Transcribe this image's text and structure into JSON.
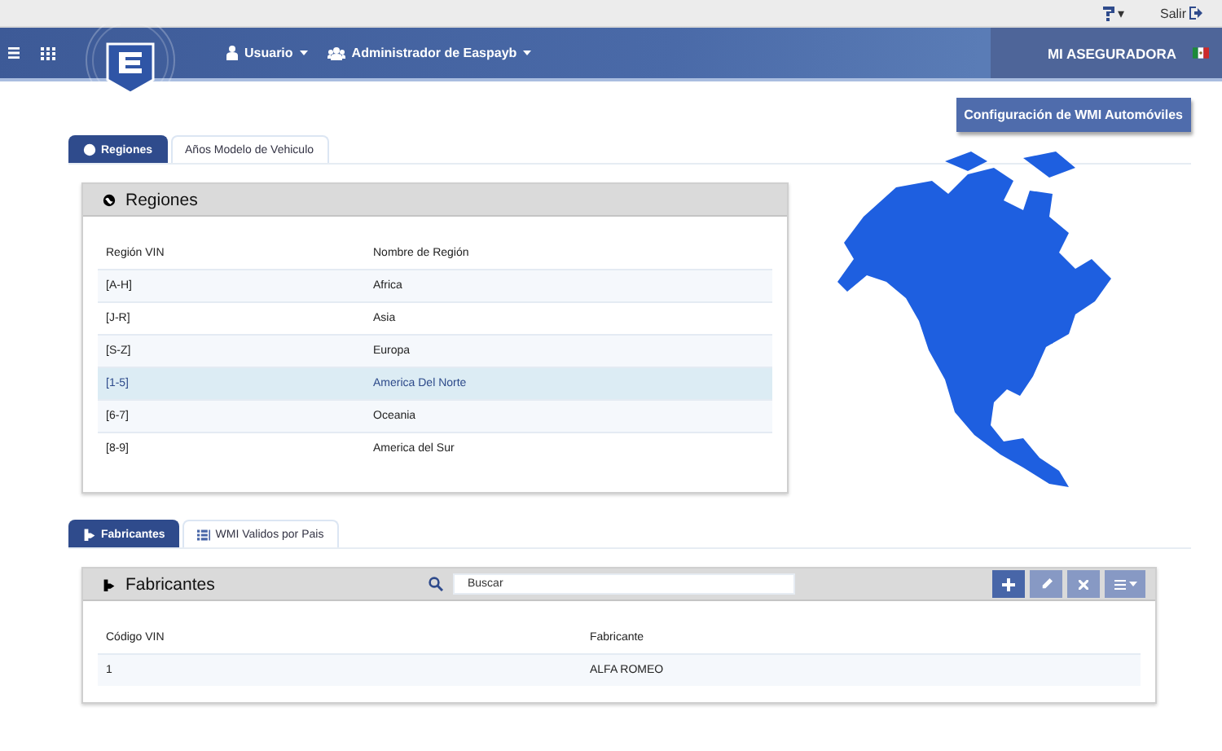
{
  "top_bar": {
    "help_caret": "▾",
    "logout": "Salir"
  },
  "header": {
    "menus": [
      {
        "label": "Usuario"
      },
      {
        "label": "Administrador de Easpayb"
      }
    ],
    "company": "MI ASEGURADORA"
  },
  "config_button": "Configuración de WMI Automóviles",
  "region_tabs": [
    {
      "label": "Regiones",
      "selected": true
    },
    {
      "label": "Años Modelo de Vehiculo",
      "selected": false
    }
  ],
  "regions_panel": {
    "title": "Regiones",
    "columns": [
      "Región VIN",
      "Nombre de Región"
    ],
    "rows": [
      {
        "cells": [
          "[A-H]",
          "Africa"
        ],
        "selected": false
      },
      {
        "cells": [
          "[J-R]",
          "Asia"
        ],
        "selected": false
      },
      {
        "cells": [
          "[S-Z]",
          "Europa"
        ],
        "selected": false
      },
      {
        "cells": [
          "[1-5]",
          "America Del Norte"
        ],
        "selected": true
      },
      {
        "cells": [
          "[6-7]",
          "Oceania"
        ],
        "selected": false
      },
      {
        "cells": [
          "[8-9]",
          "America del Sur"
        ],
        "selected": false
      }
    ]
  },
  "maker_tabs": [
    {
      "label": "Fabricantes",
      "selected": true
    },
    {
      "label": "WMI Validos por Pais",
      "selected": false
    }
  ],
  "makers_panel": {
    "title": "Fabricantes",
    "search": {
      "placeholder": "Buscar"
    },
    "actions": [
      {
        "kind": "add",
        "disabled": false
      },
      {
        "kind": "edit",
        "disabled": true
      },
      {
        "kind": "delete",
        "disabled": true
      },
      {
        "kind": "menu",
        "disabled": true
      }
    ],
    "columns": [
      "Código VIN",
      "Fabricante"
    ],
    "rows": [
      {
        "cells": [
          "1",
          "ALFA ROMEO"
        ],
        "selected": false
      }
    ]
  }
}
